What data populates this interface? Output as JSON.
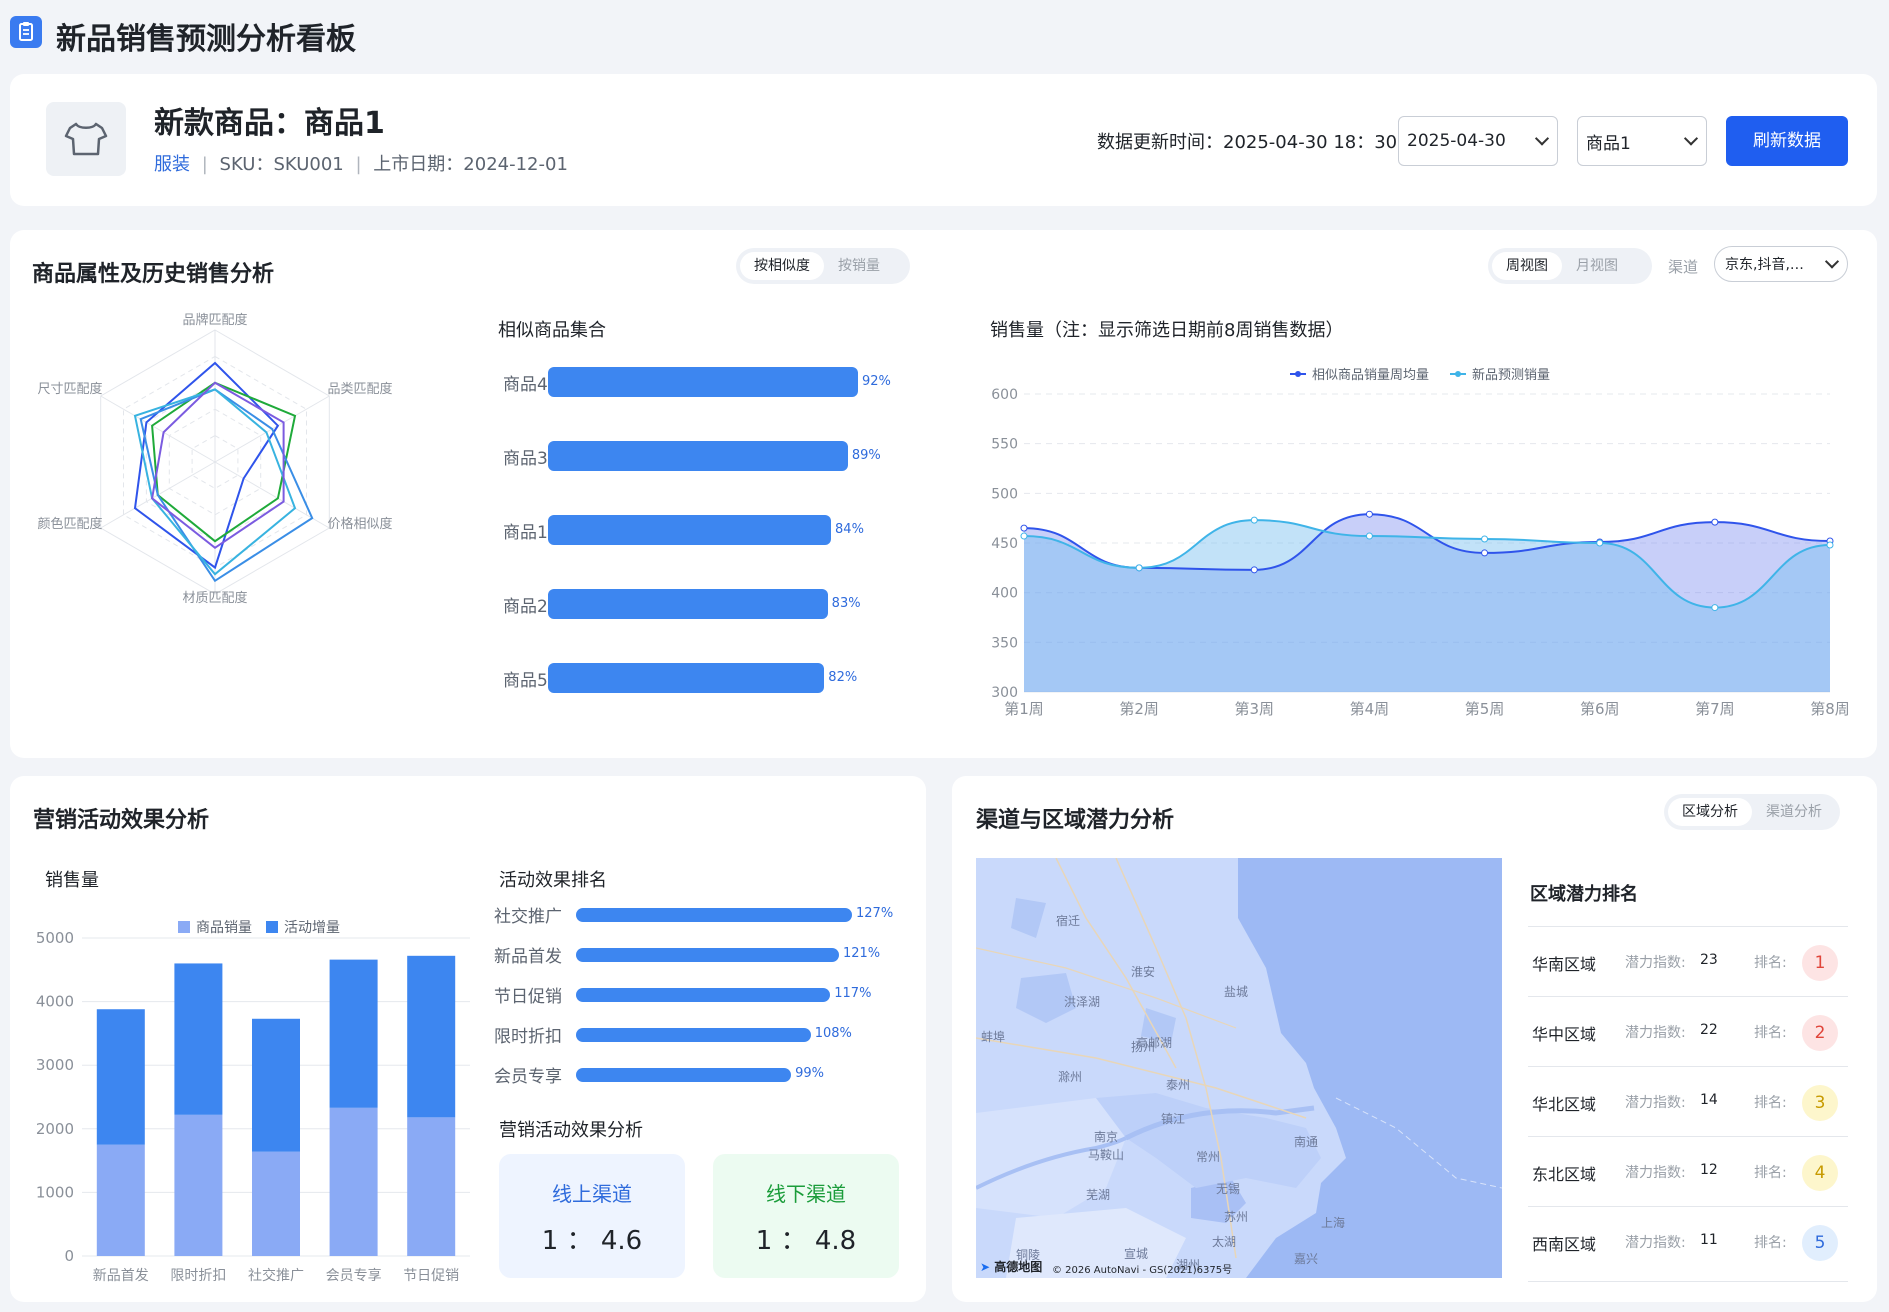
{
  "header": {
    "title": "新品销售预测分析看板"
  },
  "product": {
    "name": "新款商品：商品1",
    "category": "服装",
    "sku": "SKU：SKU001",
    "launch": "上市日期：2024-12-01",
    "sep": "|",
    "update_time": "数据更新时间：2025-04-30 18：30",
    "date_select": "2025-04-30",
    "product_select": "商品1",
    "refresh_label": "刷新数据"
  },
  "attr_section": {
    "title": "商品属性及历史销售分析",
    "toggle": [
      "按相似度",
      "按销量"
    ],
    "view_toggle": [
      "周视图",
      "月视图"
    ],
    "channel_label": "渠道",
    "channel_value": "京东,抖音,…"
  },
  "radar": {
    "axes": [
      "品牌匹配度",
      "品类匹配度",
      "价格相似度",
      "材质匹配度",
      "颜色匹配度",
      "尺寸匹配度"
    ],
    "series": [
      {
        "color": "#2f54eb",
        "values": [
          0.75,
          0.55,
          0.25,
          0.8,
          0.7,
          0.6
        ]
      },
      {
        "color": "#1faa3a",
        "values": [
          0.6,
          0.7,
          0.55,
          0.6,
          0.5,
          0.55
        ]
      },
      {
        "color": "#3a8ee6",
        "values": [
          0.55,
          0.5,
          0.85,
          0.9,
          0.5,
          0.65
        ]
      },
      {
        "color": "#38b3e0",
        "values": [
          0.55,
          0.45,
          0.7,
          0.85,
          0.55,
          0.7
        ]
      },
      {
        "color": "#7b5be0",
        "values": [
          0.6,
          0.6,
          0.6,
          0.65,
          0.55,
          0.45
        ]
      }
    ]
  },
  "similar": {
    "title": "相似商品集合",
    "items": [
      {
        "name": "商品4",
        "pct": 92,
        "label": "92%"
      },
      {
        "name": "商品3",
        "pct": 89,
        "label": "89%"
      },
      {
        "name": "商品1",
        "pct": 84,
        "label": "84%"
      },
      {
        "name": "商品2",
        "pct": 83,
        "label": "83%"
      },
      {
        "name": "商品5",
        "pct": 82,
        "label": "82%"
      }
    ]
  },
  "chart_data": [
    {
      "type": "area",
      "title": "销售量（注：显示筛选日期前8周销售数据）",
      "categories": [
        "第1周",
        "第2周",
        "第3周",
        "第4周",
        "第5周",
        "第6周",
        "第7周",
        "第8周"
      ],
      "series": [
        {
          "name": "相似商品销量周均量",
          "color": "#2f54eb",
          "values": [
            465,
            425,
            423,
            479,
            440,
            451,
            471,
            452
          ]
        },
        {
          "name": "新品预测销量",
          "color": "#3fb4e8",
          "values": [
            457,
            425,
            473,
            457,
            454,
            450,
            385,
            448
          ]
        }
      ],
      "ylim": [
        300,
        600
      ],
      "yticks": [
        300,
        350,
        400,
        450,
        500,
        550,
        600
      ],
      "grid": true,
      "legend": "top-center"
    },
    {
      "type": "bar",
      "title": "销售量",
      "stacked": true,
      "categories": [
        "新品首发",
        "限时折扣",
        "社交推广",
        "会员专享",
        "节日促销"
      ],
      "series": [
        {
          "name": "商品销量",
          "color": "#8aaaf5",
          "values": [
            1750,
            2220,
            1640,
            2330,
            2180
          ]
        },
        {
          "name": "活动增量",
          "color": "#3d86f0",
          "values": [
            2130,
            2380,
            2090,
            2330,
            2540
          ]
        }
      ],
      "ylim": [
        0,
        5000
      ],
      "yticks": [
        0,
        1000,
        2000,
        3000,
        4000,
        5000
      ],
      "legend": "top-center"
    }
  ],
  "marketing": {
    "title": "营销活动效果分析",
    "ranking_title": "活动效果排名",
    "ranking": [
      {
        "name": "社交推广",
        "pct": 127,
        "label": "127%"
      },
      {
        "name": "新品首发",
        "pct": 121,
        "label": "121%"
      },
      {
        "name": "节日促销",
        "pct": 117,
        "label": "117%"
      },
      {
        "name": "限时折扣",
        "pct": 108,
        "label": "108%"
      },
      {
        "name": "会员专享",
        "pct": 99,
        "label": "99%"
      }
    ],
    "effect_title": "营销活动效果分析",
    "online": {
      "label": "线上渠道",
      "ratio": "1 ： 4.6"
    },
    "offline": {
      "label": "线下渠道",
      "ratio": "1 ： 4.8"
    }
  },
  "region": {
    "title": "渠道与区域潜力分析",
    "toggle": [
      "区域分析",
      "渠道分析"
    ],
    "rank_title": "区域潜力排名",
    "index_label": "潜力指数:",
    "rank_label": "排名:",
    "items": [
      {
        "name": "华南区域",
        "index": "23",
        "rank": "1"
      },
      {
        "name": "华中区域",
        "index": "22",
        "rank": "2"
      },
      {
        "name": "华北区域",
        "index": "14",
        "rank": "3"
      },
      {
        "name": "东北区域",
        "index": "12",
        "rank": "4"
      },
      {
        "name": "西南区域",
        "index": "11",
        "rank": "5"
      }
    ],
    "map": {
      "cities": [
        "宿迁",
        "淮安",
        "盐城",
        "泰州",
        "扬州",
        "镇江",
        "南京",
        "常州",
        "无锡",
        "南通",
        "苏州",
        "上海",
        "芜湖",
        "马鞍山",
        "湖州",
        "嘉兴",
        "宣城",
        "铜陵",
        "蚌埠",
        "洪泽湖",
        "高邮湖",
        "太湖",
        "滁州"
      ],
      "logo": "高德地图",
      "copyright": "© 2026 AutoNavi - GS(2021)6375号"
    }
  }
}
